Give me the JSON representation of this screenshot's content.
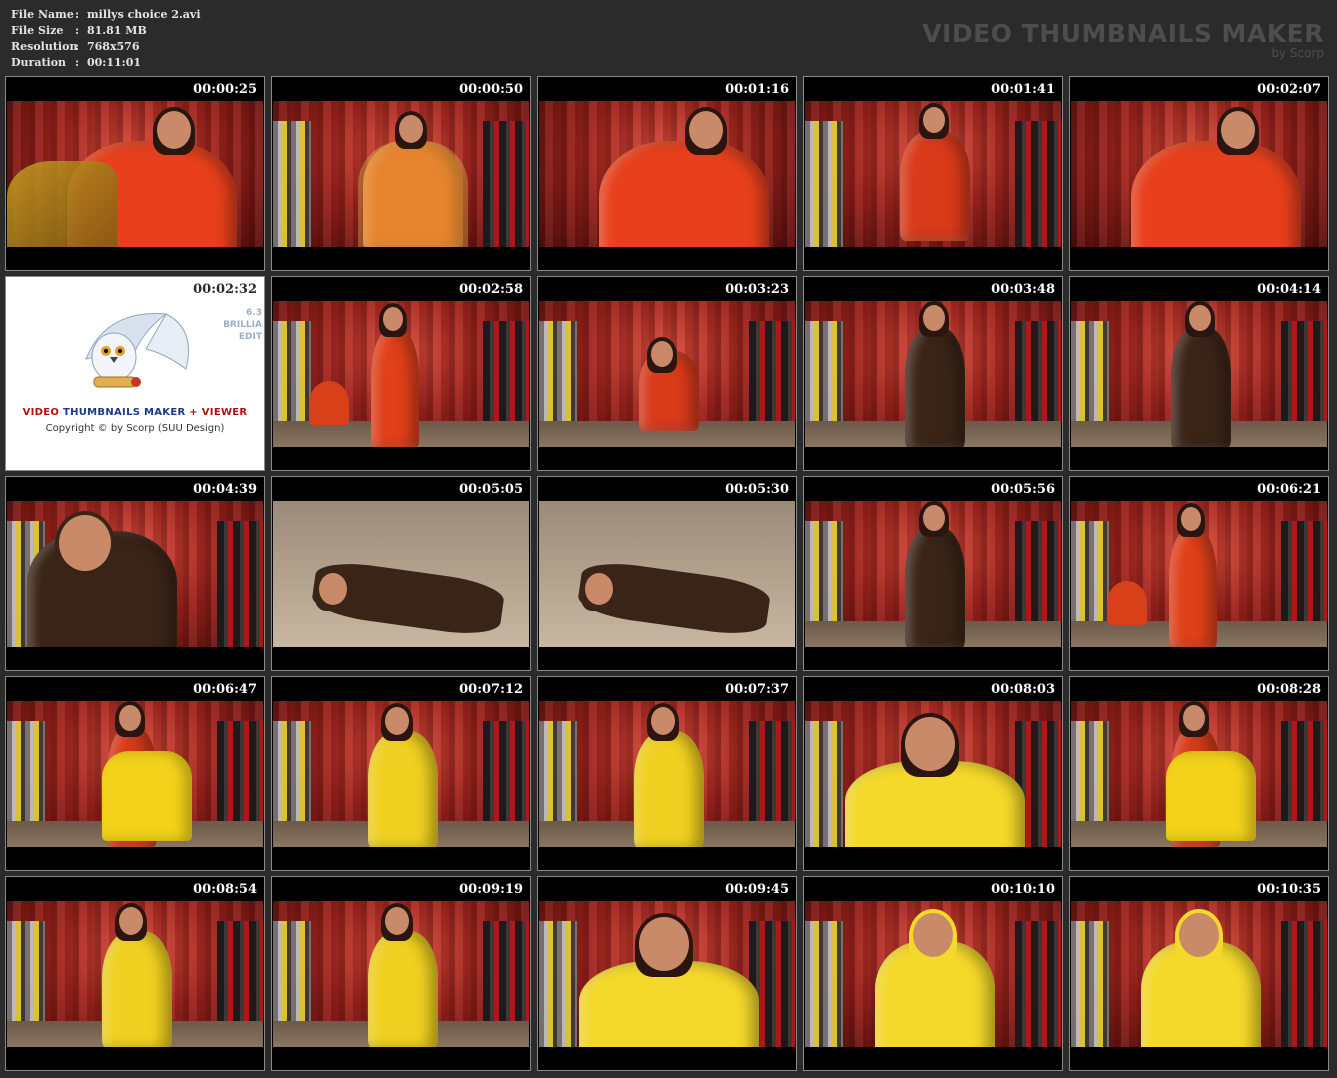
{
  "file_info": [
    {
      "label": "File Name",
      "value": "millys choice 2.avi"
    },
    {
      "label": "File Size",
      "value": "81.81 MB"
    },
    {
      "label": "Resolution",
      "value": "768x576"
    },
    {
      "label": "Duration",
      "value": "00:11:01"
    }
  ],
  "separator": ":",
  "brand": {
    "title": "VIDEO THUMBNAILS MAKER",
    "subtitle": "by Scorp"
  },
  "logo": {
    "title_part1": "VIDEO",
    "title_part2": "THUMBNAILS MAKER",
    "title_part3": "+ VIEWER",
    "copyright": "Copyright © by Scorp (SUU Design)",
    "version_1": "6.3",
    "version_2": "BRILLIA",
    "version_3": "EDIT"
  },
  "thumbnails": [
    {
      "time": "00:00:25",
      "scene": "closeup-red"
    },
    {
      "time": "00:00:50",
      "scene": "red-clear"
    },
    {
      "time": "00:01:16",
      "scene": "closeup-red"
    },
    {
      "time": "00:01:41",
      "scene": "seated-red"
    },
    {
      "time": "00:02:07",
      "scene": "closeup-red"
    },
    {
      "time": "00:02:32",
      "scene": "logo"
    },
    {
      "time": "00:02:58",
      "scene": "standing-red"
    },
    {
      "time": "00:03:23",
      "scene": "bending"
    },
    {
      "time": "00:03:48",
      "scene": "standing-brown"
    },
    {
      "time": "00:04:14",
      "scene": "standing-brown"
    },
    {
      "time": "00:04:39",
      "scene": "hood-brown"
    },
    {
      "time": "00:05:05",
      "scene": "floor-brown"
    },
    {
      "time": "00:05:30",
      "scene": "floor-brown"
    },
    {
      "time": "00:05:56",
      "scene": "standing-brown"
    },
    {
      "time": "00:06:21",
      "scene": "standing-red"
    },
    {
      "time": "00:06:47",
      "scene": "holding-yellow"
    },
    {
      "time": "00:07:12",
      "scene": "standing-yellow"
    },
    {
      "time": "00:07:37",
      "scene": "standing-yellow"
    },
    {
      "time": "00:08:03",
      "scene": "closeup-yellow"
    },
    {
      "time": "00:08:28",
      "scene": "holding-yellow"
    },
    {
      "time": "00:08:54",
      "scene": "standing-yellow"
    },
    {
      "time": "00:09:19",
      "scene": "standing-yellow"
    },
    {
      "time": "00:09:45",
      "scene": "closeup-yellow"
    },
    {
      "time": "00:10:10",
      "scene": "hood-yellow"
    },
    {
      "time": "00:10:35",
      "scene": "hood-yellow"
    }
  ]
}
